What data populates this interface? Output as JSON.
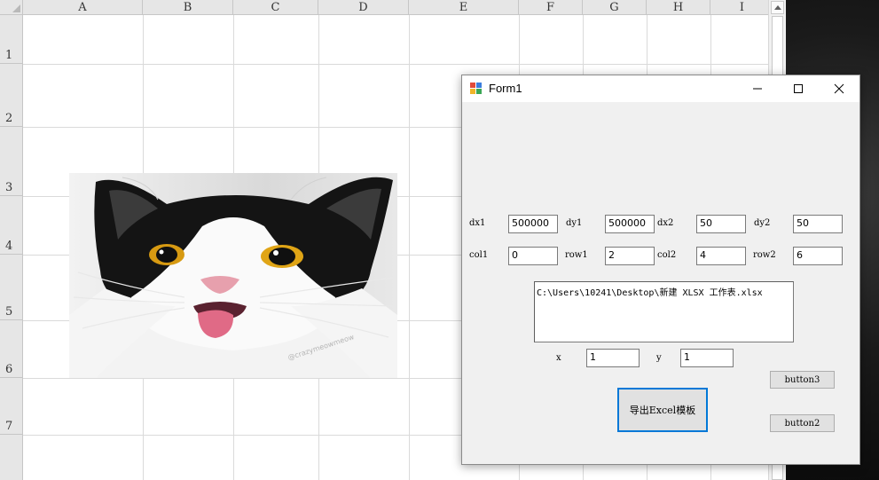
{
  "spreadsheet": {
    "columns": [
      "A",
      "B",
      "C",
      "D",
      "E",
      "F",
      "G",
      "H",
      "I"
    ],
    "rows": [
      "1",
      "2",
      "3",
      "4",
      "5",
      "6",
      "7"
    ]
  },
  "form": {
    "title": "Form1",
    "fields": {
      "dx1": {
        "label": "dx1",
        "value": "500000"
      },
      "dy1": {
        "label": "dy1",
        "value": "500000"
      },
      "dx2": {
        "label": "dx2",
        "value": "50"
      },
      "dy2": {
        "label": "dy2",
        "value": "50"
      },
      "col1": {
        "label": "col1",
        "value": "0"
      },
      "row1": {
        "label": "row1",
        "value": "2"
      },
      "col2": {
        "label": "col2",
        "value": "4"
      },
      "row2": {
        "label": "row2",
        "value": "6"
      },
      "x": {
        "label": "x",
        "value": "1"
      },
      "y": {
        "label": "y",
        "value": "1"
      }
    },
    "path": "C:\\Users\\10241\\Desktop\\新建 XLSX 工作表.xlsx",
    "buttons": {
      "export": "导出Excel模板",
      "button3": "button3",
      "button2": "button2"
    }
  },
  "image": {
    "watermark": "@crazymeowmeow"
  },
  "colors": {
    "accent": "#0078d7",
    "grid": "#dadada",
    "header": "#e6e6e6",
    "window": "#f0f0f0"
  }
}
